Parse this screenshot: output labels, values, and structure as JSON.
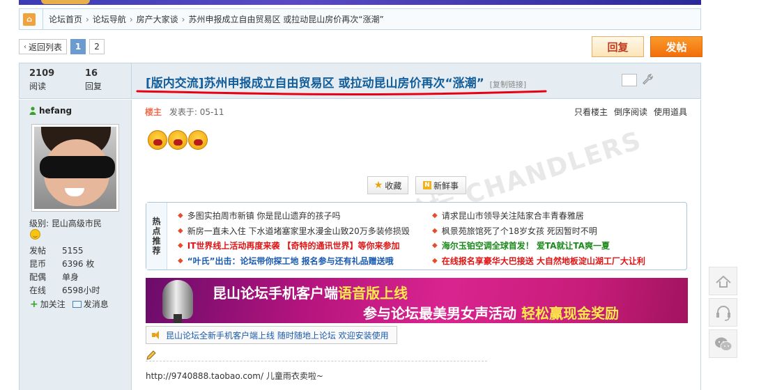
{
  "breadcrumb": {
    "items": [
      "论坛首页",
      "论坛导航",
      "房产大家谈",
      "苏州申报成立自由贸易区 或拉动昆山房价再次“涨潮”"
    ]
  },
  "pager": {
    "back_label": "返回列表",
    "pages": [
      "1",
      "2"
    ],
    "current_page": "1"
  },
  "toolbar": {
    "reply_label": "回复",
    "post_label": "发帖"
  },
  "thread": {
    "views_count": "2109",
    "views_label": "阅读",
    "replies_count": "16",
    "replies_label": "回复",
    "category": "[版内交流]",
    "title": "苏州申报成立自由贸易区 或拉动昆山房价再次“涨潮”",
    "copy_link": "[复制链接]"
  },
  "author": {
    "name": "hefang",
    "level_label": "级别:",
    "level": "昆山高级市民",
    "profile": [
      {
        "key": "发帖",
        "value": "5155"
      },
      {
        "key": "昆币",
        "value": "6396 枚"
      },
      {
        "key": "配偶",
        "value": "单身"
      },
      {
        "key": "在线",
        "value": "6598小时"
      }
    ],
    "follow_label": "加关注",
    "message_label": "发消息"
  },
  "post": {
    "owner_label": "楼主",
    "posted_at": "发表于: 05-11",
    "tools": [
      "只看楼主",
      "倒序阅读",
      "使用道具"
    ],
    "favorite_label": "收藏",
    "fresh_label": "新鲜事",
    "fresh_icon_letter": "N",
    "watermark": "昆山论坛 CHANDLERS",
    "text": "http://9740888.taobao.com/ 儿童雨衣卖啦~"
  },
  "hot": {
    "label_chars": [
      "热",
      "点",
      "推",
      "荐"
    ],
    "left": [
      {
        "text": "多图实拍周市新镇 你是昆山遗弃的孩子吗",
        "style": ""
      },
      {
        "text": "新房一直未入住 下水道堵塞家里水漫金山致20万多装修损毁",
        "style": ""
      },
      {
        "text": "IT世界线上活动再度来袭 【奇特的通讯世界】等你来参加",
        "style": "red"
      },
      {
        "text": "“叶氏”出击：论坛带你探工地 报名参与还有礼品赠送哦",
        "style": "blue"
      }
    ],
    "right": [
      {
        "text": "请求昆山市领导关注陆家合丰青春雅居",
        "style": ""
      },
      {
        "text": "枫景苑旅馆死了个18岁女孩 死因暂时不明",
        "style": ""
      },
      {
        "text": "海尔玉铂空调全球首发！ 爱TA就让TA爽一夏",
        "style": "green"
      },
      {
        "text": "在线报名享豪华大巴接送 大自然地板淀山湖工厂大让利",
        "style": "red"
      }
    ]
  },
  "banner": {
    "line1_a": "昆山论坛手机客户端",
    "line1_b": "语音版上线",
    "line2_a": "参与论坛最美男女声活动",
    "line2_b": "轻松赢现金奖励"
  },
  "notice": {
    "text": "昆山论坛全新手机客户端上线 随时随地上论坛 欢迎安装使用"
  },
  "colors": {
    "link_blue": "#125d9a",
    "post_orange": "#f26f0b",
    "owner_red": "#f26c4f",
    "highlight_red": "#e60012"
  },
  "icons": [
    "home-icon",
    "back-arrow-icon",
    "wrench-icon",
    "online-user-icon",
    "smiley-icon",
    "plus-icon",
    "message-icon",
    "star-icon",
    "fresh-icon",
    "speaker-icon",
    "pencil-icon",
    "back-to-top-icon",
    "customer-service-icon",
    "wechat-icon"
  ]
}
